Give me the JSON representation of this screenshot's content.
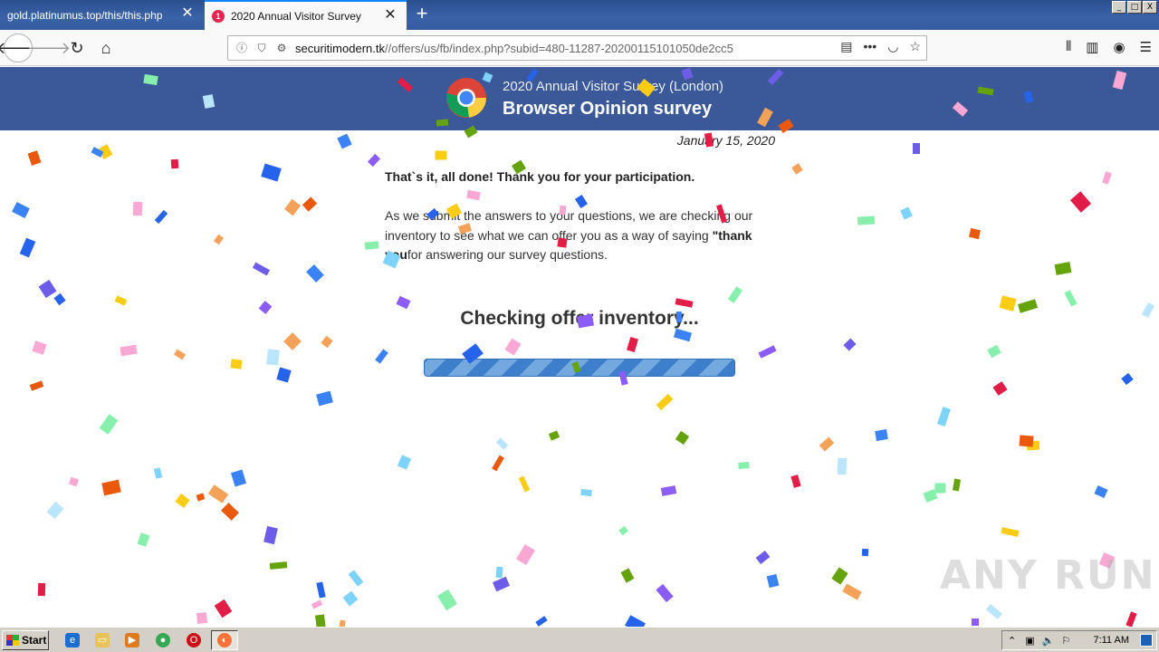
{
  "browser": {
    "tabs": [
      {
        "title": "gold.platinumus.top/this/this.php",
        "active": false
      },
      {
        "title": "2020 Annual Visitor Survey",
        "active": true,
        "badge": "1"
      }
    ],
    "url_host": "securitimodern.tk",
    "url_path": "//offers/us/fb/index.php?subid=480-11287-20200115101050de2cc5",
    "window_controls": [
      "_",
      "□",
      "X"
    ]
  },
  "survey": {
    "subtitle": "2020 Annual Visitor Survey (London)",
    "title": "Browser Opinion survey",
    "date": "January 15, 2020",
    "done_text": "That`s it, all done! Thank you for your participation.",
    "para_1": "As we submit the answers to your questions, we are checking our inventory to see what we can offer you as a way of saying ",
    "para_bold": "\"thank you",
    "para_2": "for answering our survey questions.",
    "checking": "Checking offer inventory...",
    "progress_fraction": 1.0
  },
  "watermark": "ANY RUN",
  "taskbar": {
    "start_label": "Start",
    "clock": "7:11 AM"
  },
  "colors": {
    "header_bg": "#3b5998",
    "tab_bar": "#3a63a8",
    "progress": "#3d7fcb"
  }
}
